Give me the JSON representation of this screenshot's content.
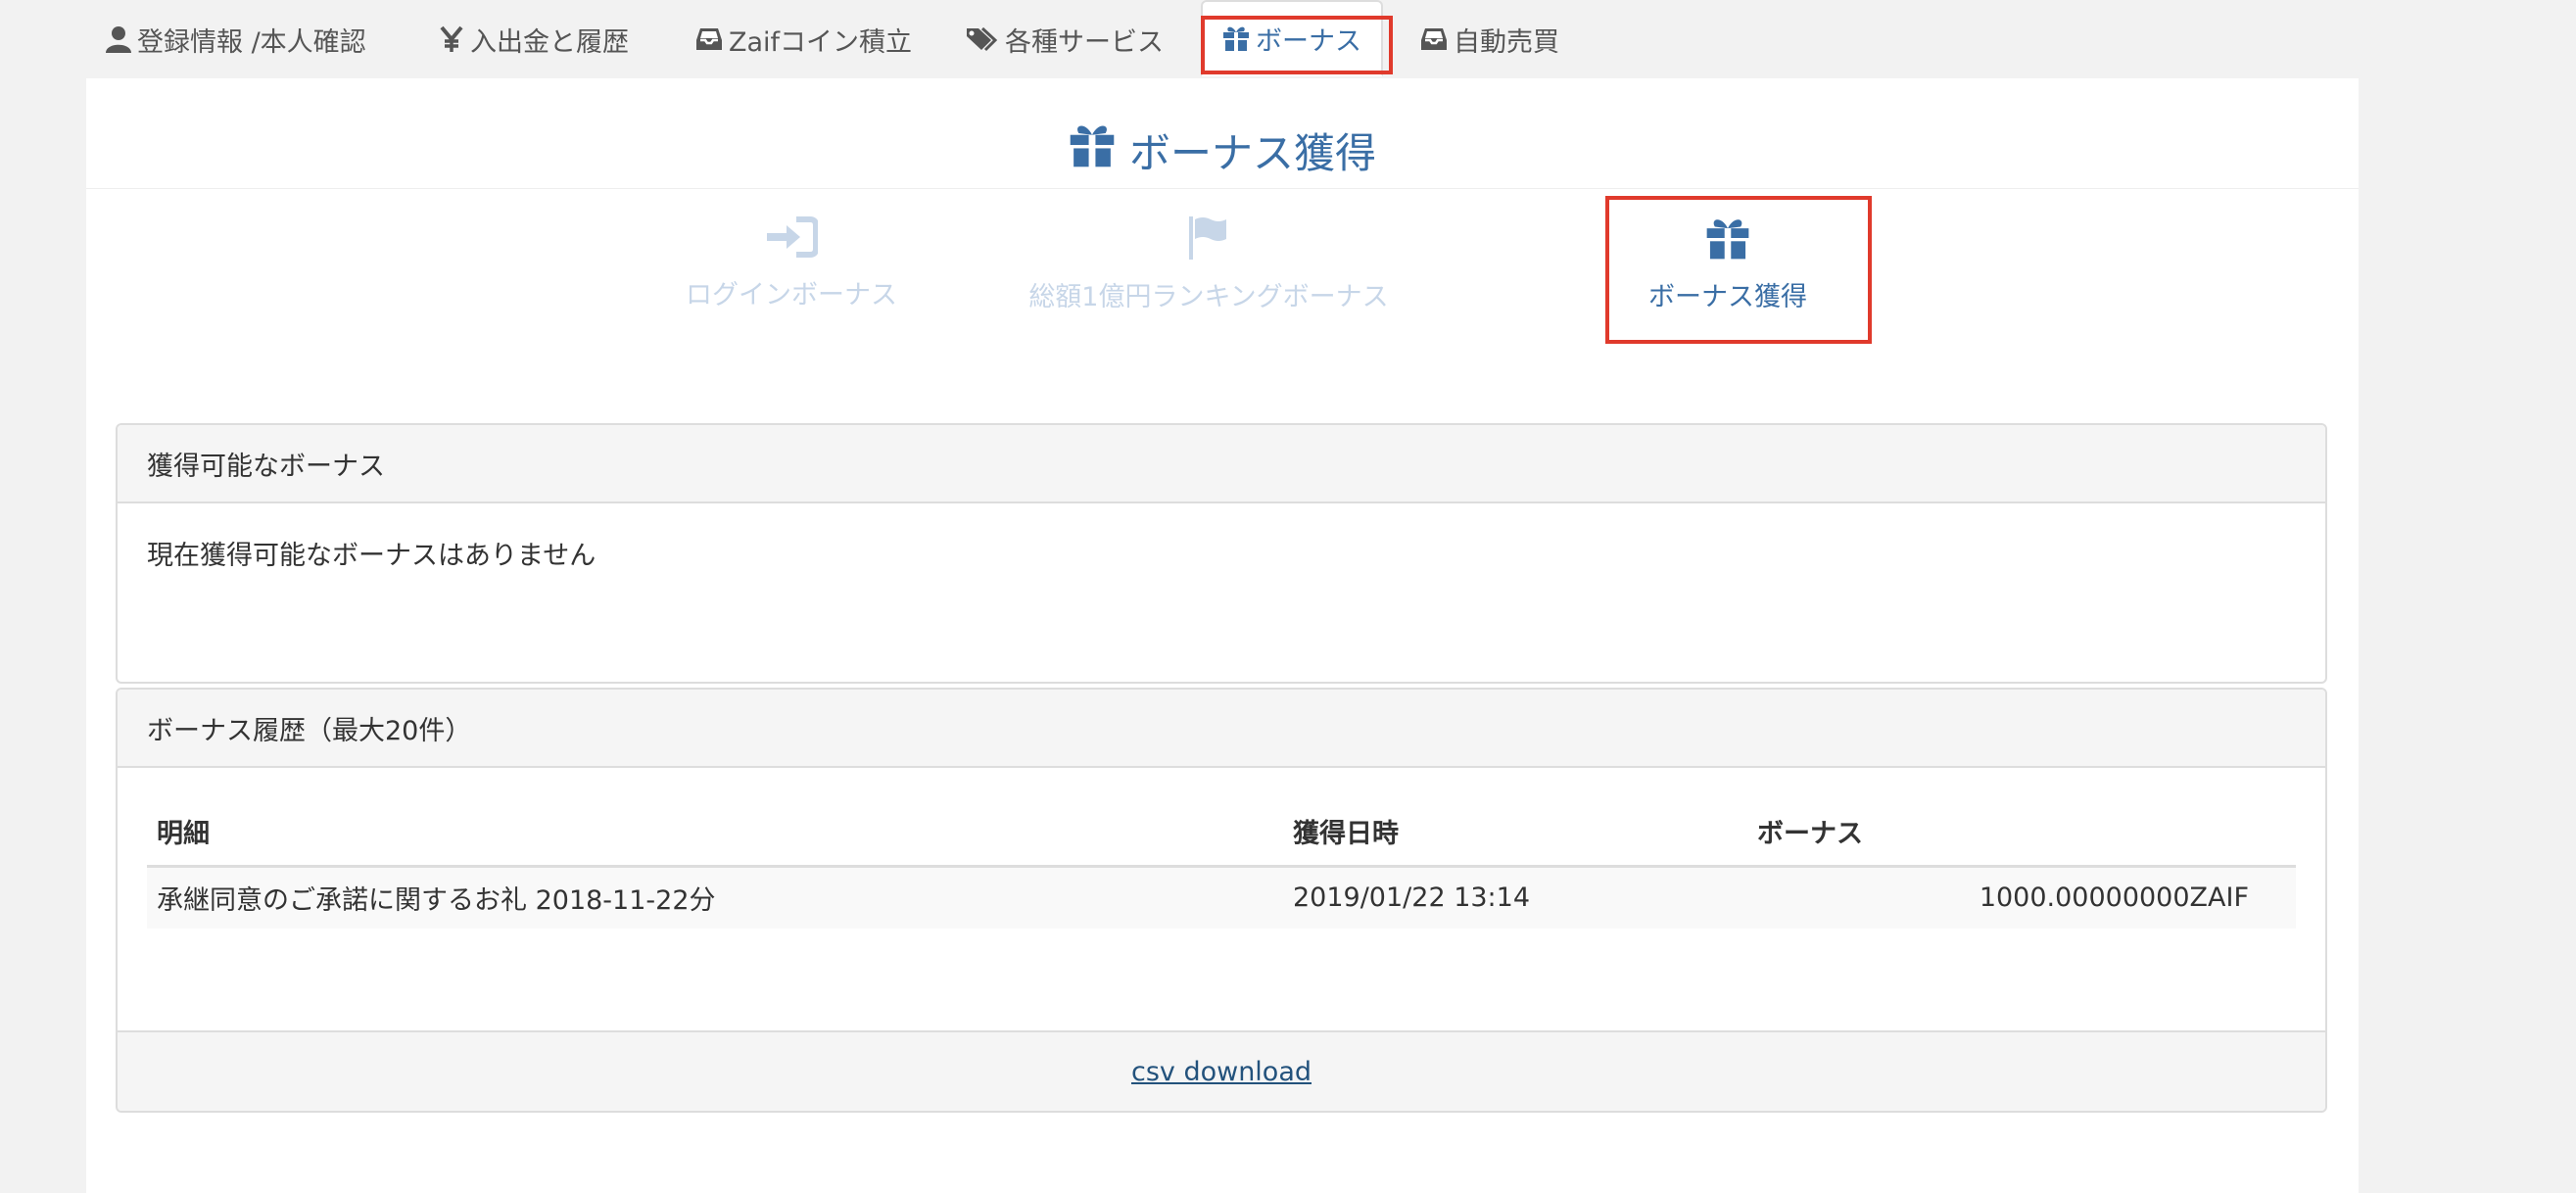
{
  "tabs": [
    {
      "label": "登録情報 /本人確認",
      "icon": "user-icon"
    },
    {
      "label": "入出金と履歴",
      "icon": "yen-icon"
    },
    {
      "label": "Zaifコイン積立",
      "icon": "inbox-icon"
    },
    {
      "label": "各種サービス",
      "icon": "tags-icon"
    },
    {
      "label": "ボーナス",
      "icon": "gift-icon",
      "active": true
    },
    {
      "label": "自動売買",
      "icon": "inbox-icon"
    }
  ],
  "page": {
    "title": "ボーナス獲得",
    "title_icon": "gift-icon"
  },
  "subnav": [
    {
      "label": "ログインボーナス",
      "icon": "sign-in-icon"
    },
    {
      "label": "総額1億円ランキングボーナス",
      "icon": "flag-icon"
    },
    {
      "label": "ボーナス獲得",
      "icon": "gift-icon",
      "active": true
    }
  ],
  "available": {
    "heading": "獲得可能なボーナス",
    "message": "現在獲得可能なボーナスはありません"
  },
  "history": {
    "heading": "ボーナス履歴（最大20件）",
    "columns": [
      "明細",
      "獲得日時",
      "ボーナス"
    ],
    "rows": [
      {
        "detail": "承継同意のご承諾に関するお礼 2018-11-22分",
        "date": "2019/01/22 13:14",
        "bonus": "1000.00000000ZAIF"
      }
    ],
    "csv_label": "csv download"
  },
  "colors": {
    "accent": "#3a6ea5",
    "muted": "#c7d6e8",
    "highlight": "#e03a2c",
    "link": "#23527c"
  }
}
